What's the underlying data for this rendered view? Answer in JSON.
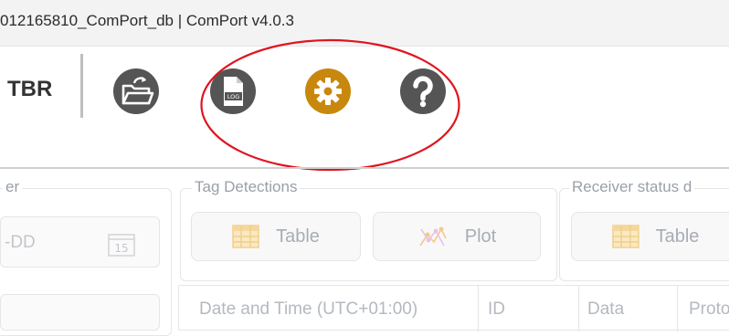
{
  "window": {
    "title": "012165810_ComPort_db | ComPort v4.0.3"
  },
  "toolbar": {
    "brand": "TBR",
    "icons": [
      {
        "name": "open-folder-icon",
        "color": "#555555"
      },
      {
        "name": "log-file-icon",
        "label": "LOG",
        "color": "#555555"
      },
      {
        "name": "settings-gear-icon",
        "color": "#C8880E"
      },
      {
        "name": "help-question-icon",
        "color": "#555555"
      }
    ],
    "annotation_color": "#E0141E"
  },
  "receiver_panel": {
    "title": "er",
    "date_placeholder": "-DD",
    "calendar_day": "15"
  },
  "tag_detections": {
    "title": "Tag Detections",
    "table_label": "Table",
    "plot_label": "Plot"
  },
  "receiver_status": {
    "title": "Receiver status d",
    "table_label": "Table"
  },
  "detections_table": {
    "columns": [
      "Date and Time (UTC+01:00)",
      "ID",
      "Data",
      "Proto"
    ]
  }
}
